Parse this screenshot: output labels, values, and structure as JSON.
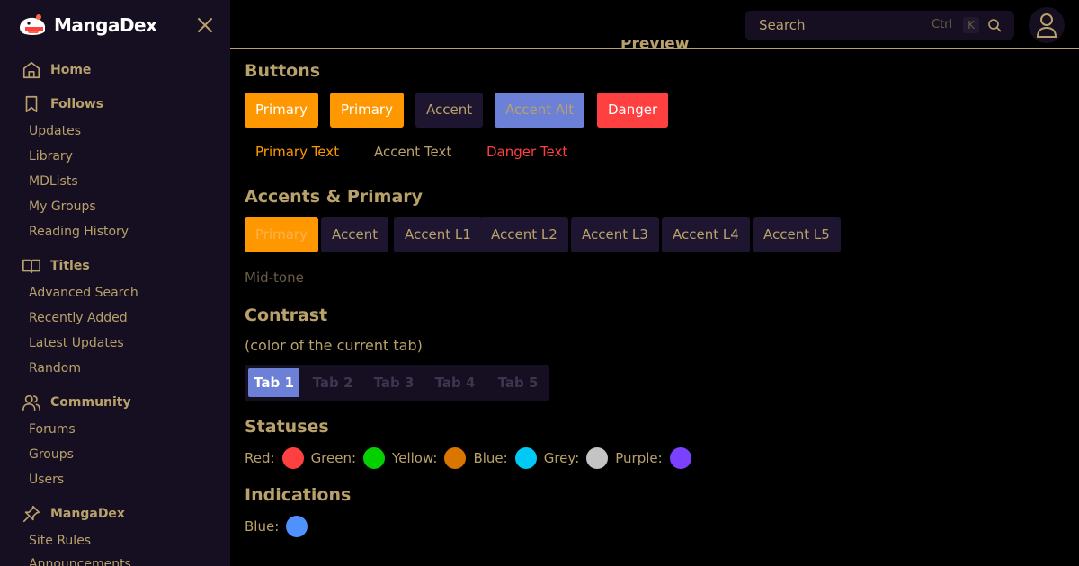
{
  "brand": {
    "name": "MangaDex"
  },
  "sidebar": {
    "sections": [
      {
        "label": "Home",
        "icon": "home-icon"
      },
      {
        "label": "Follows",
        "icon": "bookmark-icon",
        "items": [
          "Updates",
          "Library",
          "MDLists",
          "My Groups",
          "Reading History"
        ]
      },
      {
        "label": "Titles",
        "icon": "book-icon",
        "items": [
          "Advanced Search",
          "Recently Added",
          "Latest Updates",
          "Random"
        ]
      },
      {
        "label": "Community",
        "icon": "users-icon",
        "items": [
          "Forums",
          "Groups",
          "Users"
        ]
      },
      {
        "label": "MangaDex",
        "icon": "pin-icon",
        "items": [
          "Site Rules",
          "Announcements"
        ]
      }
    ]
  },
  "header": {
    "search_placeholder": "Search",
    "kbd_ctrl": "Ctrl",
    "kbd_k": "K",
    "preview_peek": "Preview"
  },
  "main": {
    "buttons_heading": "Buttons",
    "buttons": [
      "Primary",
      "Primary",
      "Accent",
      "Accent Alt",
      "Danger"
    ],
    "text_buttons": [
      "Primary Text",
      "Accent Text",
      "Danger Text"
    ],
    "accents_heading": "Accents & Primary",
    "accents": [
      "Primary",
      "Accent",
      "Accent L1",
      "Accent L2",
      "Accent L3",
      "Accent L4",
      "Accent L5"
    ],
    "midtone": "Mid-tone",
    "contrast_heading": "Contrast",
    "contrast_sub": "(color of the current tab)",
    "tabs": [
      "Tab 1",
      "Tab 2",
      "Tab 3",
      "Tab 4",
      "Tab 5"
    ],
    "statuses_heading": "Statuses",
    "statuses": [
      {
        "label": "Red:",
        "color": "#ff4040"
      },
      {
        "label": "Green:",
        "color": "#04d000"
      },
      {
        "label": "Yellow:",
        "color": "#da7500"
      },
      {
        "label": "Blue:",
        "color": "#00c9f5"
      },
      {
        "label": "Grey:",
        "color": "#c4c4c4"
      },
      {
        "label": "Purple:",
        "color": "#7c40ff"
      }
    ],
    "indications_heading": "Indications",
    "indications": [
      {
        "label": "Blue:",
        "color": "#4f91ff"
      }
    ]
  },
  "colors": {
    "primary": "#ff9800",
    "accent": "#1e1530",
    "accent_alt": "#6b80d6",
    "danger": "#ff4040",
    "text": "#b8a16a",
    "sidebar_bg": "#160f22"
  }
}
